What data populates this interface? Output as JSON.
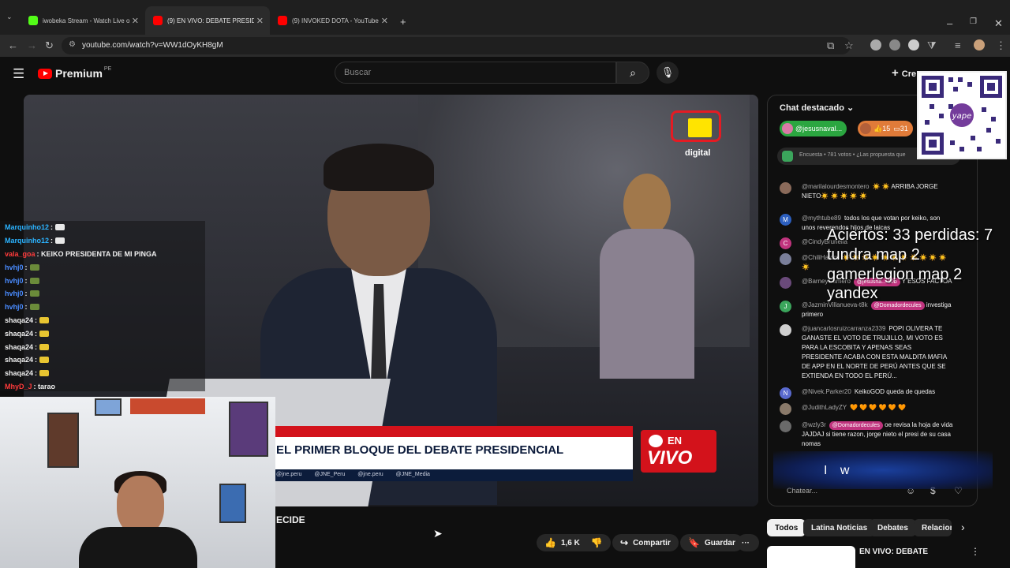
{
  "browser": {
    "tabs": [
      {
        "title": "iwobeka Stream - Watch Live o",
        "color": "#53fc18"
      },
      {
        "title": "(9) EN VIVO: DEBATE PRESIDEN",
        "color": "#ff0000"
      },
      {
        "title": "(9) INVOKED DOTA - YouTube",
        "color": "#ff0000"
      }
    ],
    "new_tab": "+",
    "url": "youtube.com/watch?v=WW1dOyKH8gM"
  },
  "yt": {
    "logo": "Premium",
    "region": "PE",
    "search_placeholder": "Buscar",
    "create_label": "Cre"
  },
  "video": {
    "lower_third": "EL PRIMER BLOQUE DEL DEBATE PRESIDENCIAL",
    "social_handles": "@jne.peru  @JNE_Peru  @jne.peru  @JNE_Media",
    "badge_en": "EN",
    "badge_vivo": "VIVO",
    "jne_sub": "digital",
    "title_fragment": "ECIDE"
  },
  "stream_chat": [
    {
      "user": "Marquinho12",
      "text": ":",
      "color": "#2bb3ff",
      "emo": "#e8e8e8"
    },
    {
      "user": "Marquinho12",
      "text": ":",
      "color": "#2bb3ff",
      "emo": "#e8e8e8"
    },
    {
      "user": "vala_goa",
      "text": ": KEIKO PRESIDENTA DE MI PINGA",
      "color": "#ff3b3b",
      "emo": ""
    },
    {
      "user": "hvhj0",
      "text": ":",
      "color": "#4a8cff",
      "emo": "#6b8b3a"
    },
    {
      "user": "hvhj0",
      "text": ":",
      "color": "#4a8cff",
      "emo": "#6b8b3a"
    },
    {
      "user": "hvhj0",
      "text": ":",
      "color": "#4a8cff",
      "emo": "#6b8b3a"
    },
    {
      "user": "hvhj0",
      "text": ":",
      "color": "#4a8cff",
      "emo": "#6b8b3a"
    },
    {
      "user": "shaqa24",
      "text": ":",
      "color": "#f1f1f1",
      "emo": "#e8c531"
    },
    {
      "user": "shaqa24",
      "text": ":",
      "color": "#f1f1f1",
      "emo": "#e8c531"
    },
    {
      "user": "shaqa24",
      "text": ":",
      "color": "#f1f1f1",
      "emo": "#e8c531"
    },
    {
      "user": "shaqa24",
      "text": ":",
      "color": "#f1f1f1",
      "emo": "#e8c531"
    },
    {
      "user": "shaqa24",
      "text": ":",
      "color": "#f1f1f1",
      "emo": "#e8c531"
    },
    {
      "user": "MhyD_J",
      "text": ": tarao",
      "color": "#ff3b3b",
      "emo": ""
    }
  ],
  "actions": {
    "likes": "1,6 K",
    "share": "Compartir",
    "save": "Guardar",
    "more": "···"
  },
  "chat": {
    "header": "Chat destacado",
    "pinned_user": "@jesusnaval...",
    "pinned_stats_likes": "15",
    "pinned_stats_comments": "31",
    "poll": "Encuesta • 781 votos • ¿Las propuesta que",
    "input_placeholder": "Chatear...",
    "messages": [
      {
        "user": "@marilalourdesmontero",
        "text": "☀️ ☀️ ARRIBA JORGE NIETO☀️ ☀️ ☀️ ☀️ ☀️",
        "initial": "",
        "color": "#8a6a5a",
        "tag": ""
      },
      {
        "user": "@mythtube89",
        "text": "todos los que votan por keiko, son unos reverendos hijos de laicas",
        "initial": "M",
        "color": "#2c5fbf",
        "tag": ""
      },
      {
        "user": "@CindyBrunella",
        "text": "",
        "initial": "C",
        "color": "#c0347e",
        "tag": ""
      },
      {
        "user": "@ChiliHatoru",
        "text": "☀️ ☀️ ☀️ ☀️ ☀️ ☀️ ☀️ ☀️ ☀️ ☀️ ☀️ ☀️",
        "initial": "",
        "color": "#7a7f9a",
        "tag": ""
      },
      {
        "user": "@BarneyCamero",
        "text": "Y ESOS FACTOA",
        "initial": "",
        "color": "#6a4a7a",
        "tag": "@jesusna... 10b"
      },
      {
        "user": "@JazminVillanueva-t8k",
        "text": "investiga primero",
        "initial": "J",
        "color": "#3ba55c",
        "tag": "@Domadordecules"
      },
      {
        "user": "@juancarlosruizcarranza2339",
        "text": "POPI OLIVERA TE GANASTE EL VOTO DE TRUJILLO, MI VOTO ES PARA LA ESCOBITA Y APENAS SEAS PRESIDENTE ACABA CON ESTA MALDITA MAFIA DE APP EN EL NORTE DE PERÚ ANTES QUE SE EXTIENDA EN TODO EL PERÚ...",
        "initial": "",
        "color": "#cfcfcf",
        "tag": ""
      },
      {
        "user": "@Nivek.Parker20",
        "text": "KeikoGOD queda de quedas",
        "initial": "N",
        "color": "#5a6acf",
        "tag": ""
      },
      {
        "user": "@JudithLadyZY",
        "text": "🧡 🧡 🧡 🧡 🧡 🧡",
        "initial": "",
        "color": "#8a7a6a",
        "tag": ""
      },
      {
        "user": "@wzly3r",
        "text": "oe revisa la hoja de vida JAJDAJ si tiene razon, jorge nieto el presi de su casa nomas",
        "initial": "",
        "color": "#6a6a6a",
        "tag": "@Domadordecules"
      }
    ]
  },
  "stream_overlay": {
    "stats": "Aciertos: 33 perdidas: 7",
    "line2": "tundra map 2",
    "line3": "gamerlegion map 2",
    "line4": "yandex",
    "sparkle_text": "I w"
  },
  "chips": [
    "Todos",
    "Latina Noticias",
    "Debates",
    "Relacion"
  ],
  "recommended": {
    "title": "EN VIVO: DEBATE"
  }
}
